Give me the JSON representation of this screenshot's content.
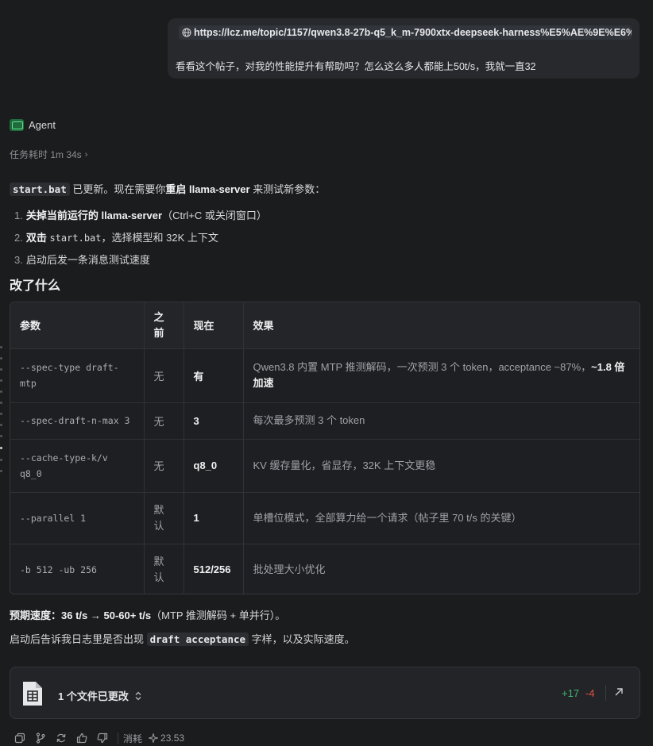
{
  "user_message": {
    "url": "https://lcz.me/topic/1157/qwen3.8-27b-q5_k_m-7900xtx-deepseek-harness%E5%AE%9E%E6%...",
    "text": "看看这个帖子，对我的性能提升有帮助吗？怎么这么多人都能上50t/s，我就一直32"
  },
  "agent": {
    "name": "Agent",
    "task_time": "任务耗时 1m 34s"
  },
  "intro": {
    "code": "start.bat",
    "t1": " 已更新。现在需要你",
    "b1": "重启 llama-server",
    "t2": " 来测试新参数："
  },
  "steps": [
    {
      "num": "1.",
      "bold": "关掉当前运行的 llama-server",
      "rest": "（Ctrl+C 或关闭窗口）"
    },
    {
      "num": "2.",
      "bold": "双击",
      "code": "start.bat",
      "rest": "，选择模型和 32K 上下文"
    },
    {
      "num": "3.",
      "text": "启动后发一条消息测试速度"
    }
  ],
  "section_title": "改了什么",
  "table": {
    "headers": [
      "参数",
      "之前",
      "现在",
      "效果"
    ],
    "rows": [
      {
        "param": "--spec-type draft-mtp",
        "before": "无",
        "now": "有",
        "effect": "Qwen3.8 内置 MTP 推测解码，一次预测 3 个 token，acceptance ~87%，",
        "effect_bold": "~1.8 倍加速"
      },
      {
        "param": "--spec-draft-n-max 3",
        "before": "无",
        "now": "3",
        "effect": "每次最多预测 3 个 token",
        "effect_bold": ""
      },
      {
        "param": "--cache-type-k/v q8_0",
        "before": "无",
        "now": "q8_0",
        "effect": "KV 缓存量化，省显存，32K 上下文更稳",
        "effect_bold": ""
      },
      {
        "param": "--parallel 1",
        "before": "默认",
        "now": "1",
        "effect": "单槽位模式，全部算力给一个请求（帖子里 70 t/s 的关键）",
        "effect_bold": ""
      },
      {
        "param": "-b 512 -ub 256",
        "before": "默认",
        "now": "512/256",
        "effect": "批处理大小优化",
        "effect_bold": ""
      }
    ]
  },
  "expected": {
    "label": "预期速度：",
    "value": "36 t/s → 50-60+ t/s",
    "note": "（MTP 推测解码 + 单并行）。"
  },
  "followup": {
    "t1": "启动后告诉我日志里是否出现 ",
    "code": "draft acceptance",
    "t2": " 字样，以及实际速度。"
  },
  "files_card": {
    "label": "1 个文件已更改",
    "additions": "+17",
    "deletions": "-4"
  },
  "toolbar": {
    "cost_label": "消耗",
    "cost_value": "23.53"
  }
}
